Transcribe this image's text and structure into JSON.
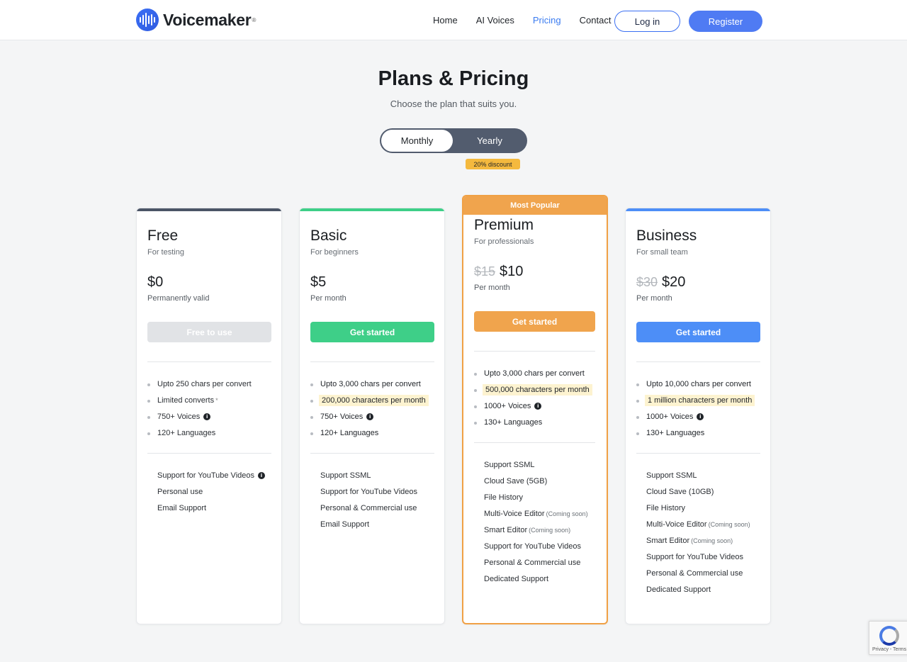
{
  "brand": {
    "name": "Voicemaker",
    "reg": "®"
  },
  "nav": {
    "items": [
      "Home",
      "AI Voices",
      "Pricing",
      "Contact"
    ],
    "active": "Pricing",
    "login": "Log in",
    "register": "Register"
  },
  "page": {
    "title": "Plans & Pricing",
    "subtitle": "Choose the plan that suits you."
  },
  "billing": {
    "monthly": "Monthly",
    "yearly": "Yearly",
    "selected": "Monthly",
    "discount": "20% discount"
  },
  "plans": [
    {
      "name": "Free",
      "for": "For testing",
      "old_price": "",
      "price": "$0",
      "price_note": "Permanently valid",
      "cta": "Free to use",
      "accent": "#4b5566",
      "button_color": "#e1e3e6",
      "features": [
        {
          "text": "Upto 250 chars per convert"
        },
        {
          "text": "Limited converts",
          "suffix": "*"
        },
        {
          "text": "750+ Voices",
          "info": true
        },
        {
          "text": "120+ Languages"
        }
      ],
      "extras": [
        {
          "text": "Support for YouTube Videos",
          "info": true
        },
        {
          "text": "Personal use"
        },
        {
          "text": "Email Support"
        }
      ]
    },
    {
      "name": "Basic",
      "for": "For beginners",
      "old_price": "",
      "price": "$5",
      "price_note": "Per month",
      "cta": "Get started",
      "accent": "#3ecf88",
      "button_color": "#3ecf88",
      "features": [
        {
          "text": "Upto 3,000 chars per convert"
        },
        {
          "text": "200,000 characters per month",
          "highlight": true
        },
        {
          "text": "750+ Voices",
          "info": true
        },
        {
          "text": "120+ Languages"
        }
      ],
      "extras": [
        {
          "text": "Support SSML"
        },
        {
          "text": "Support for YouTube Videos"
        },
        {
          "text": "Personal & Commercial use"
        },
        {
          "text": "Email Support"
        }
      ]
    },
    {
      "name": "Premium",
      "for": "For professionals",
      "badge": "Most Popular",
      "old_price": "$15",
      "price": "$10",
      "price_note": "Per month",
      "cta": "Get started",
      "accent": "#f0a44d",
      "button_color": "#f0a44d",
      "features": [
        {
          "text": "Upto 3,000 chars per convert"
        },
        {
          "text": "500,000 characters per month",
          "highlight": true
        },
        {
          "text": "1000+ Voices",
          "info": true
        },
        {
          "text": "130+ Languages"
        }
      ],
      "extras": [
        {
          "text": "Support SSML"
        },
        {
          "text": "Cloud Save (5GB)"
        },
        {
          "text": "File History"
        },
        {
          "text": "Multi-Voice Editor",
          "note": "(Coming soon)"
        },
        {
          "text": "Smart Editor",
          "note": "(Coming soon)"
        },
        {
          "text": "Support for YouTube Videos"
        },
        {
          "text": "Personal & Commercial use"
        },
        {
          "text": "Dedicated Support"
        }
      ]
    },
    {
      "name": "Business",
      "for": "For small team",
      "old_price": "$30",
      "price": "$20",
      "price_note": "Per month",
      "cta": "Get started",
      "accent": "#4d8ef7",
      "button_color": "#4d8ef7",
      "features": [
        {
          "text": "Upto 10,000 chars per convert"
        },
        {
          "text": "1 million characters per month",
          "highlight": true
        },
        {
          "text": "1000+ Voices",
          "info": true
        },
        {
          "text": "130+ Languages"
        }
      ],
      "extras": [
        {
          "text": "Support SSML"
        },
        {
          "text": "Cloud Save (10GB)"
        },
        {
          "text": "File History"
        },
        {
          "text": "Multi-Voice Editor",
          "note": "(Coming soon)"
        },
        {
          "text": "Smart Editor",
          "note": "(Coming soon)"
        },
        {
          "text": "Support for YouTube Videos"
        },
        {
          "text": "Personal & Commercial use"
        },
        {
          "text": "Dedicated Support"
        }
      ]
    }
  ],
  "recaptcha": {
    "text": "Privacy - Terms"
  }
}
